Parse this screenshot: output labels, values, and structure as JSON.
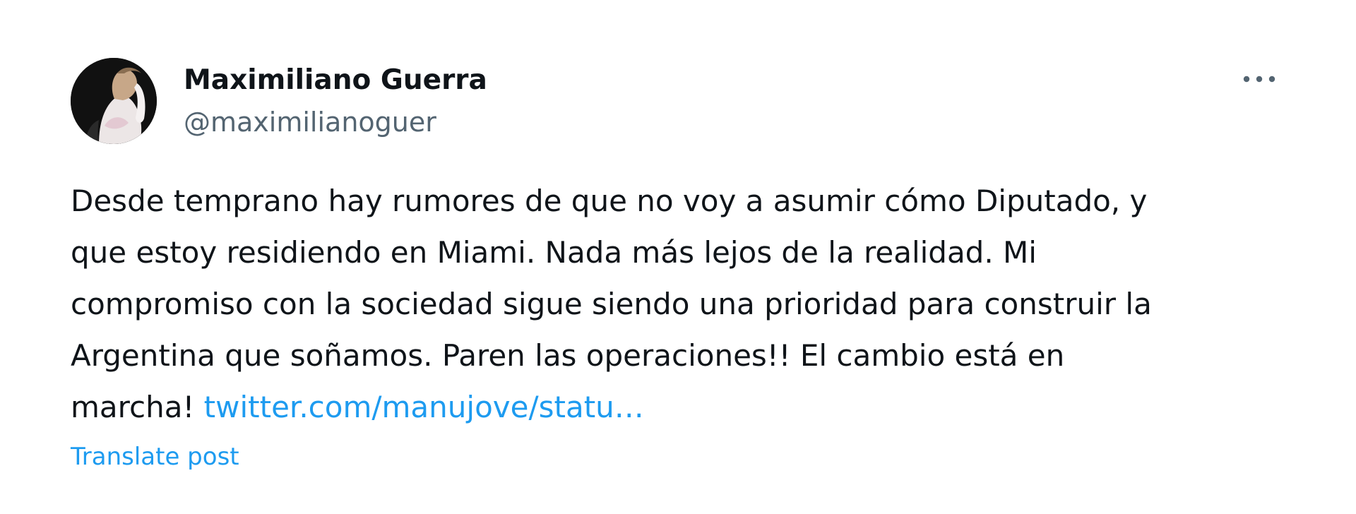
{
  "post": {
    "author": {
      "display_name": "Maximiliano Guerra",
      "handle": "@maximilianoguer",
      "avatar_icon": "profile-photo"
    },
    "more_icon": "more-horizontal-icon",
    "text_lines": [
      "Desde temprano hay rumores de que no voy a asumir cómo Diputado, y",
      "que estoy residiendo en Miami. Nada más lejos de la realidad. Mi",
      "compromiso con la sociedad sigue siendo una prioridad para construir la",
      "Argentina que soñamos. Paren las operaciones!! El cambio está en",
      "marcha! "
    ],
    "link_text": "twitter.com/manujove/statu…",
    "translate_label": "Translate post"
  },
  "colors": {
    "text_primary": "#0f1419",
    "text_secondary": "#536471",
    "accent": "#1d9bf0",
    "background": "#ffffff"
  }
}
